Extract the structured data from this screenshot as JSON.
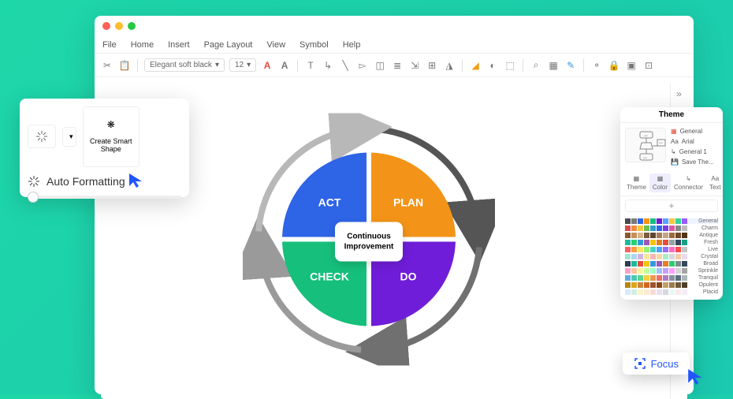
{
  "menubar": {
    "file": "File",
    "home": "Home",
    "insert": "Insert",
    "page": "Page Layout",
    "view": "View",
    "symbol": "Symbol",
    "help": "Help"
  },
  "toolbar": {
    "font": "Elegant soft black",
    "size": "12"
  },
  "smart": {
    "create": "Create Smart\nShape",
    "auto": "Auto Formatting"
  },
  "pdca": {
    "act": "ACT",
    "plan": "PLAN",
    "check": "CHECK",
    "do": "DO",
    "center": "Continuous\nImprovement"
  },
  "theme": {
    "title": "Theme",
    "opts": {
      "general": "General",
      "arial": "Arial",
      "g1": "General 1",
      "save": "Save The..."
    },
    "tabs": {
      "theme": "Theme",
      "color": "Color",
      "connector": "Connector",
      "text": "Text"
    },
    "add": "+",
    "palettes": [
      "General",
      "Charm",
      "Antique",
      "Fresh",
      "Live",
      "Crystal",
      "Broad",
      "Sprinkle",
      "Tranquil",
      "Opulent",
      "Placid"
    ]
  },
  "focus": {
    "label": "Focus"
  },
  "colors": {
    "rows": [
      [
        "#4a4a4a",
        "#7a7a7a",
        "#2e64e6",
        "#f39418",
        "#16bf7c",
        "#6f1dd8",
        "#5aa0ff",
        "#f3c843",
        "#35d29a",
        "#9b5cff"
      ],
      [
        "#d84b4b",
        "#f08c3a",
        "#f3c843",
        "#6fbf4a",
        "#2aa0c8",
        "#2e64e6",
        "#7a3be6",
        "#d85aa0",
        "#888",
        "#bbb"
      ],
      [
        "#8b5a2b",
        "#c58f58",
        "#d9b38c",
        "#7a5c3e",
        "#5e4632",
        "#a67c52",
        "#c4a484",
        "#9c6b3d",
        "#6e4b2a",
        "#503418"
      ],
      [
        "#1abc9c",
        "#2ecc71",
        "#3498db",
        "#9b59b6",
        "#f1c40f",
        "#e67e22",
        "#e74c3c",
        "#95a5a6",
        "#34495e",
        "#16a085"
      ],
      [
        "#ff5e5e",
        "#ff9e3d",
        "#ffe066",
        "#9bef6f",
        "#4ad4c4",
        "#4aa3ff",
        "#9b6bff",
        "#ff6bc4",
        "#ff4a4a",
        "#c4c4c4"
      ],
      [
        "#a3e4d7",
        "#aed6f1",
        "#d2b4de",
        "#f9e79f",
        "#f5b7b1",
        "#fad7a0",
        "#abebc6",
        "#d5d8dc",
        "#f5cba7",
        "#e8daef"
      ],
      [
        "#2c3e50",
        "#1abc9c",
        "#e74c3c",
        "#f1c40f",
        "#3498db",
        "#9b59b6",
        "#e67e22",
        "#2ecc71",
        "#7f8c8d",
        "#34495e"
      ],
      [
        "#ff9ec4",
        "#ffc49e",
        "#fff09e",
        "#c4ff9e",
        "#9effc4",
        "#9ec4ff",
        "#c49eff",
        "#ff9eff",
        "#d4d4d4",
        "#a4a4a4"
      ],
      [
        "#5dade2",
        "#48c9b0",
        "#58d68d",
        "#f4d03f",
        "#eb984e",
        "#ec7063",
        "#af7ac5",
        "#85929e",
        "#5d6d7e",
        "#aab7b8"
      ],
      [
        "#b8860b",
        "#daa520",
        "#cd853f",
        "#d2691e",
        "#a0522d",
        "#8b4513",
        "#c0a060",
        "#9c7c4c",
        "#6e5a3a",
        "#4e3e2a"
      ],
      [
        "#d6eaf8",
        "#d4efdf",
        "#fcf3cf",
        "#fdebd0",
        "#fadbd8",
        "#ebdef0",
        "#d5d8dc",
        "#e8f8f5",
        "#f9ebea",
        "#f4ecf7"
      ]
    ]
  }
}
